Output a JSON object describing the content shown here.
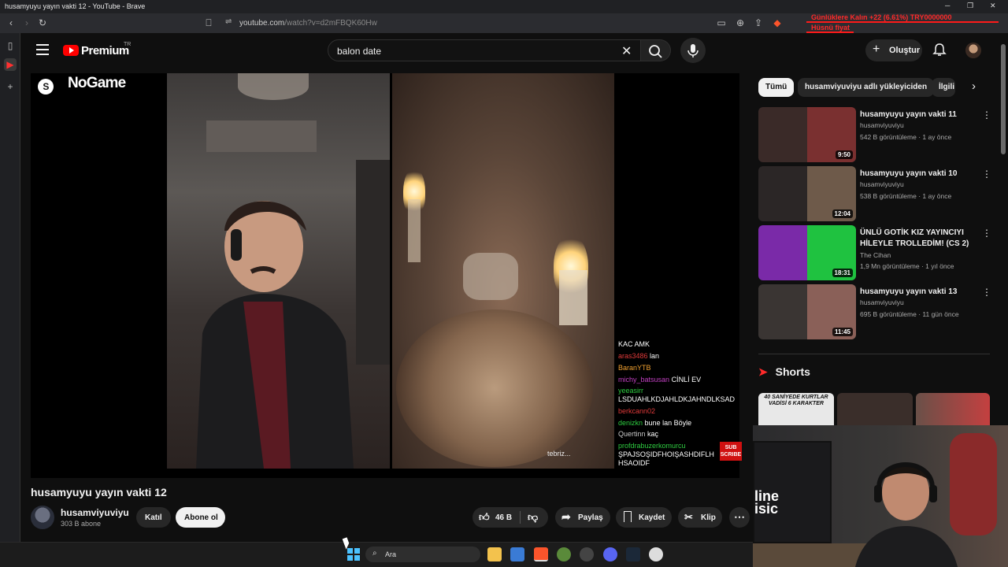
{
  "browser": {
    "window_title": "husamyuyu yayın vakti 12 - YouTube - Brave",
    "url_host": "youtube.com",
    "url_path": "/watch?v=d2mFBQK60Hw",
    "ticker": [
      "Günlüklere Kalın   +22 (6.61%)   TRY0000000",
      "Hüsnü fiyat"
    ]
  },
  "header": {
    "brand": "Premium",
    "region": "TR",
    "search_query": "balon date",
    "create_label": "Oluştur"
  },
  "player": {
    "overlay_brand": "NoGame",
    "overlay_badge": "S",
    "sub_badge": [
      "SUB",
      "SCRIBE"
    ],
    "right_caption": "tebriz...",
    "chat": [
      {
        "user": "",
        "msg": "KAC AMK",
        "color": "#ffffff"
      },
      {
        "user": "aras3486",
        "msg": "lan",
        "color": "#e03a3a"
      },
      {
        "user": "BaranYTB",
        "msg": "",
        "color": "#f0a030"
      },
      {
        "user": "michy_batsusan",
        "msg": "CİNLİ EV",
        "color": "#c040c0"
      },
      {
        "user": "yeeasirr",
        "msg": "",
        "color": "#2ecc40"
      },
      {
        "user": "",
        "msg": "LSDUAHLKDJAHLDKJAHNDLKSAD",
        "color": "#ffffff"
      },
      {
        "user": "berkcann02",
        "msg": "",
        "color": "#e03a3a"
      },
      {
        "user": "denizkn",
        "msg": "bune lan Böyle",
        "color": "#2ecc40"
      },
      {
        "user": "Quertinn",
        "msg": "kaç",
        "color": "#c8c8c8"
      },
      {
        "user": "profdrabuzerkomurcu",
        "msg": "",
        "color": "#2ecc40"
      },
      {
        "user": "",
        "msg": "ŞPAJSOŞIDFHOIŞASHDIFLH",
        "color": "#ffffff"
      },
      {
        "user": "",
        "msg": "HSAOIDF",
        "color": "#ffffff"
      }
    ]
  },
  "video": {
    "title": "husamyuyu yayın vakti 12",
    "channel": "husamviyuviyu",
    "subscribers": "303 B abone",
    "join_label": "Katıl",
    "subscribe_label": "Abone ol",
    "likes": "46 B",
    "share_label": "Paylaş",
    "save_label": "Kaydet",
    "clip_label": "Klip"
  },
  "sidebar": {
    "chips": [
      "Tümü",
      "husamviyuviyu adlı yükleyiciden",
      "İlgili"
    ],
    "recommendations": [
      {
        "title": "husamyuyu yayın vakti 11",
        "channel": "husamviyuviyu",
        "meta": "542 B görüntüleme · 1 ay önce",
        "duration": "9:50",
        "colors": [
          "#3a2a28",
          "#7a3030"
        ]
      },
      {
        "title": "husamyuyu yayın vakti 10",
        "channel": "husamviyuviyu",
        "meta": "538 B görüntüleme · 1 ay önce",
        "duration": "12:04",
        "colors": [
          "#2b2626",
          "#6e5a4a"
        ]
      },
      {
        "title": "ÜNLÜ GOTİK KIZ YAYINCIYI HİLEYLE TROLLEDİM! (CS 2)",
        "channel": "The Cihan",
        "meta": "1,9 Mn görüntüleme · 1 yıl önce",
        "duration": "18:31",
        "colors": [
          "#7a2aa8",
          "#1fc240"
        ]
      },
      {
        "title": "husamyuyu yayın vakti 13",
        "channel": "husamviyuviyu",
        "meta": "695 B görüntüleme · 11 gün önce",
        "duration": "11:45",
        "colors": [
          "#3a3533",
          "#8a6058"
        ]
      }
    ],
    "shorts_label": "Shorts",
    "short_caption": "40 SANİYEDE KURTLAR VADİSİ 6 KARAKTER"
  },
  "webcam": {
    "poster_text": [
      "line",
      "isic"
    ]
  },
  "taskbar": {
    "search_placeholder": "Ara"
  }
}
